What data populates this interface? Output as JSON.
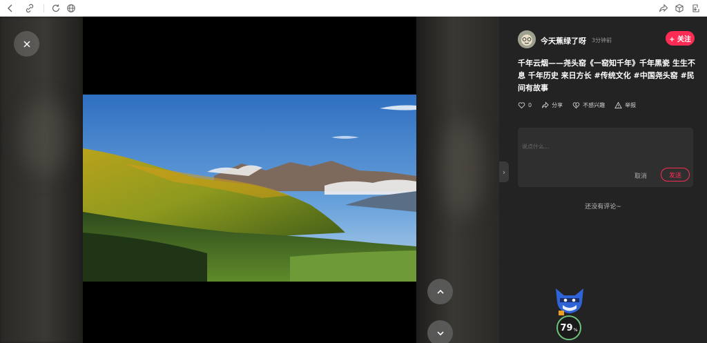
{
  "browser": {
    "icons": [
      "back-icon",
      "link-icon",
      "refresh-icon",
      "globe-icon",
      "share-icon",
      "cube-icon",
      "download-icon"
    ]
  },
  "post": {
    "author": "今天蕉绿了呀",
    "time": "3分钟前",
    "follow_label": "+ 关注",
    "text": "千年云烟——尧头窑《一窑知千年》千年黑瓷 生生不息 千年历史 来日方长 #传统文化 #中国尧头窑 #民间有故事",
    "like_count": "0",
    "share_label": "分享",
    "not_interested_label": "不感兴趣",
    "report_label": "举报"
  },
  "comment": {
    "placeholder": "说点什么...",
    "cancel_label": "取消",
    "send_label": "发送",
    "empty_text": "还没有评论~"
  },
  "widget": {
    "score": "79",
    "score_unit": "%"
  },
  "colors": {
    "accent": "#fe2c55",
    "panel_bg": "#232323",
    "viewer_bg": "#1b1a19"
  }
}
